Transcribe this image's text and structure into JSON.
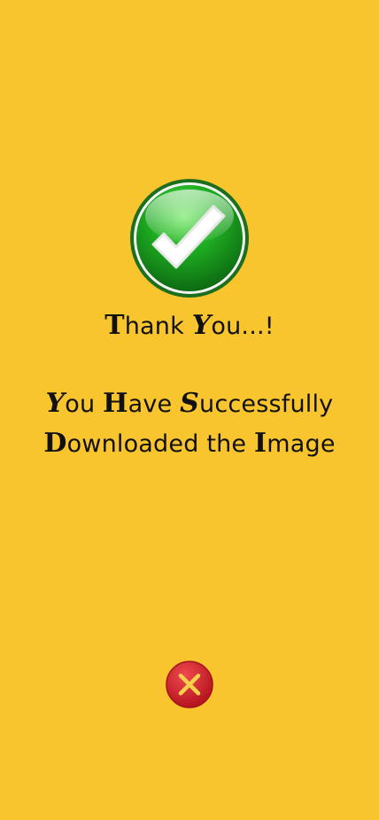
{
  "success": {
    "icon": "checkmark-circle-icon",
    "title": {
      "parts": [
        "T",
        "hank ",
        "Y",
        "ou...!"
      ]
    },
    "message": {
      "line1": [
        "Y",
        "ou ",
        "H",
        "ave ",
        "S",
        "uccessfully"
      ],
      "line2": [
        "D",
        "ownloaded the ",
        "I",
        "mage"
      ]
    }
  },
  "actions": {
    "close_icon": "close-circle-icon"
  },
  "colors": {
    "background": "#f8c52e",
    "check_green": "#1f9a1f",
    "close_red": "#d9232f",
    "close_mark": "#f6d24a",
    "text": "#111111"
  }
}
